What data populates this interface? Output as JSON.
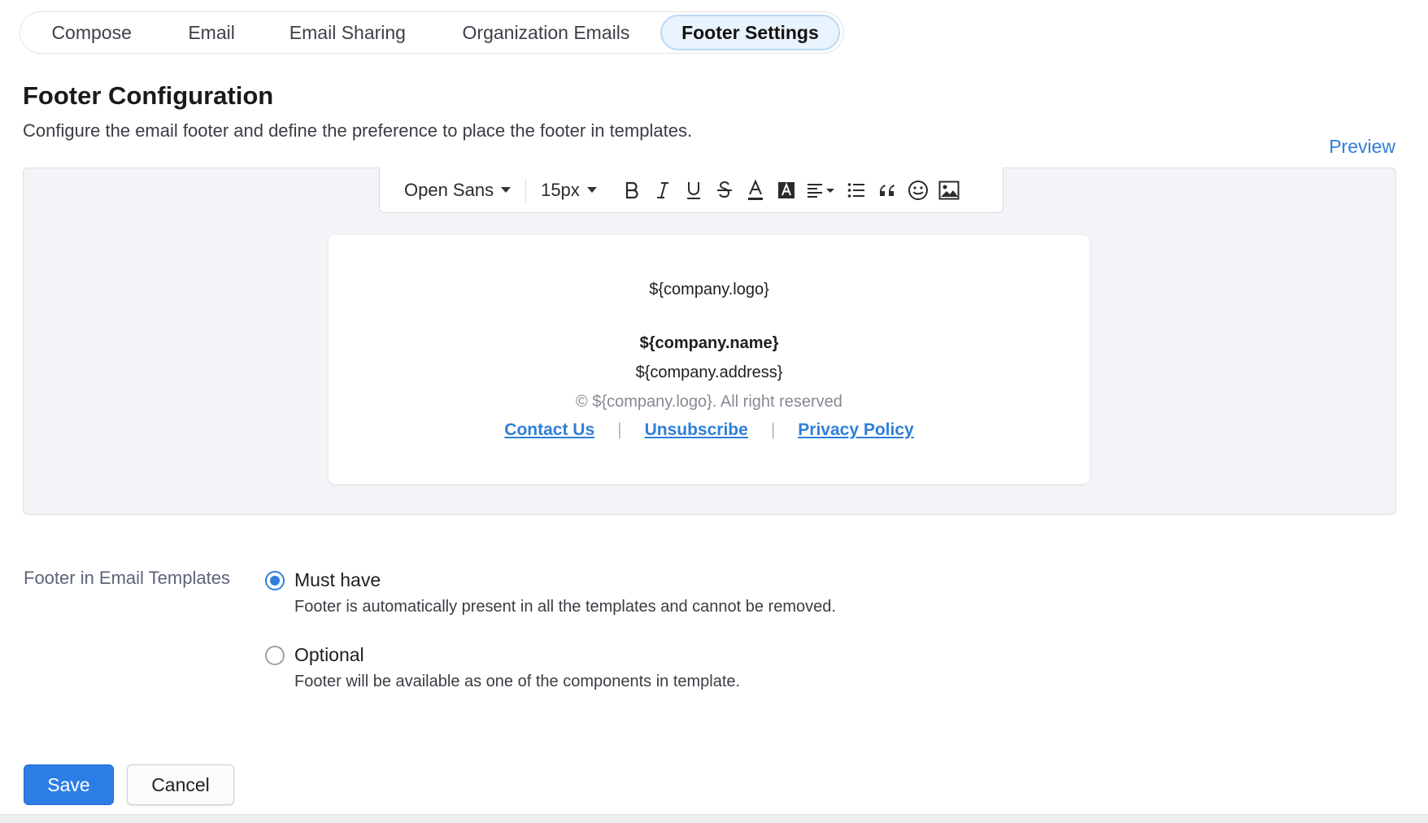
{
  "tabs": [
    {
      "label": "Compose",
      "active": false
    },
    {
      "label": "Email",
      "active": false
    },
    {
      "label": "Email Sharing",
      "active": false
    },
    {
      "label": "Organization Emails",
      "active": false
    },
    {
      "label": "Footer Settings",
      "active": true
    }
  ],
  "header": {
    "title": "Footer Configuration",
    "subtitle": "Configure the email footer and define the preference to place the footer in templates.",
    "preview_label": "Preview"
  },
  "toolbar": {
    "font_family": "Open Sans",
    "font_size": "15px",
    "icons": [
      "bold-icon",
      "italic-icon",
      "underline-icon",
      "strikethrough-icon",
      "text-color-icon",
      "highlight-color-icon",
      "align-icon",
      "list-icon",
      "blockquote-icon",
      "emoji-icon",
      "image-icon"
    ]
  },
  "footer_preview": {
    "logo": "${company.logo}",
    "name": "${company.name}",
    "address": "${company.address}",
    "copyright": "© ${company.logo}. All right reserved",
    "links": [
      "Contact Us",
      "Unsubscribe",
      "Privacy Policy"
    ],
    "separator": "|"
  },
  "options": {
    "label": "Footer in Email Templates",
    "choices": [
      {
        "label": "Must have",
        "description": "Footer is automatically present in all the templates and cannot be removed.",
        "selected": true
      },
      {
        "label": "Optional",
        "description": "Footer will be available as one of the components in template.",
        "selected": false
      }
    ]
  },
  "actions": {
    "save_label": "Save",
    "cancel_label": "Cancel"
  },
  "colors": {
    "accent": "#2f7fd8",
    "primary_button": "#2d7de6"
  }
}
